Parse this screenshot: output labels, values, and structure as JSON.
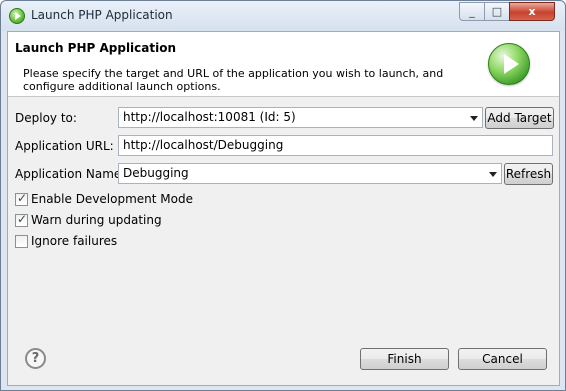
{
  "window": {
    "title": "Launch PHP Application",
    "close_glyph": "x",
    "minimize_glyph": "_",
    "maximize_glyph": "□"
  },
  "header": {
    "title": "Launch PHP Application",
    "description": "Please specify the target and URL of the application you wish to launch, and configure additional launch options."
  },
  "form": {
    "deploy_label": "Deploy to:",
    "deploy_value": "http://localhost:10081 (Id: 5)",
    "add_target_label": "Add Target",
    "url_label": "Application URL:",
    "url_value": "http://localhost/Debugging",
    "name_label": "Application Name:",
    "name_value": "Debugging",
    "refresh_label": "Refresh"
  },
  "options": [
    {
      "label": "Enable Development Mode",
      "checked": true
    },
    {
      "label": "Warn during updating",
      "checked": true
    },
    {
      "label": "Ignore failures",
      "checked": false
    }
  ],
  "footer": {
    "help_glyph": "?",
    "finish_label": "Finish",
    "cancel_label": "Cancel"
  }
}
